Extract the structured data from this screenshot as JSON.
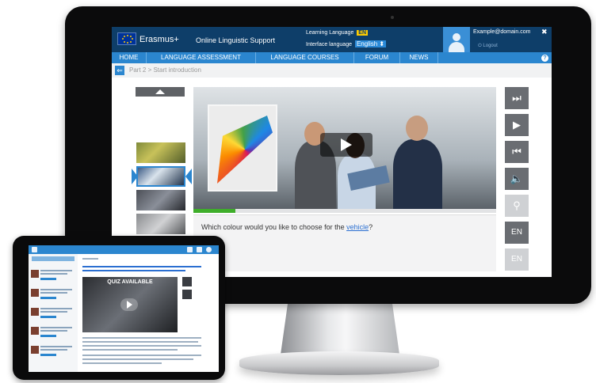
{
  "header": {
    "brand": "Erasmus+",
    "subtitle": "Online Linguistic Support",
    "learning_language_label": "Learning Language",
    "learning_language_code": "EN",
    "interface_language_label": "Interface language",
    "interface_language_value": "English ⬍",
    "user_email": "Example@domain.com",
    "logout_label": "⏻ Logout",
    "close_glyph": "✖"
  },
  "nav": {
    "items": [
      {
        "label": "HOME"
      },
      {
        "label": "LANGUAGE ASSESSMENT"
      },
      {
        "label": "LANGUAGE COURSES"
      },
      {
        "label": "FORUM"
      },
      {
        "label": "NEWS"
      }
    ],
    "help_glyph": "?"
  },
  "breadcrumb": {
    "back_glyph": "⇐",
    "text": "Part 2 > Start introduction"
  },
  "lesson": {
    "question_prefix": "Which colour would you like to choose for the ",
    "question_link": "vehicle",
    "question_suffix": "?",
    "progress_fraction": 0.14
  },
  "controls": {
    "next_glyph": "⏭",
    "play_glyph": "▶",
    "prev_glyph": "⏮",
    "volume_glyph": "🔈",
    "pin_glyph": "⚲",
    "en_label_1": "EN",
    "en_label_2": "EN"
  },
  "tablet": {
    "video_label": "QUIZ AVAILABLE"
  },
  "colors": {
    "header_bg": "#0e3e69",
    "nav_bg": "#2b86cf",
    "badge_yellow": "#ffcc00",
    "progress_green": "#3fae2a"
  }
}
